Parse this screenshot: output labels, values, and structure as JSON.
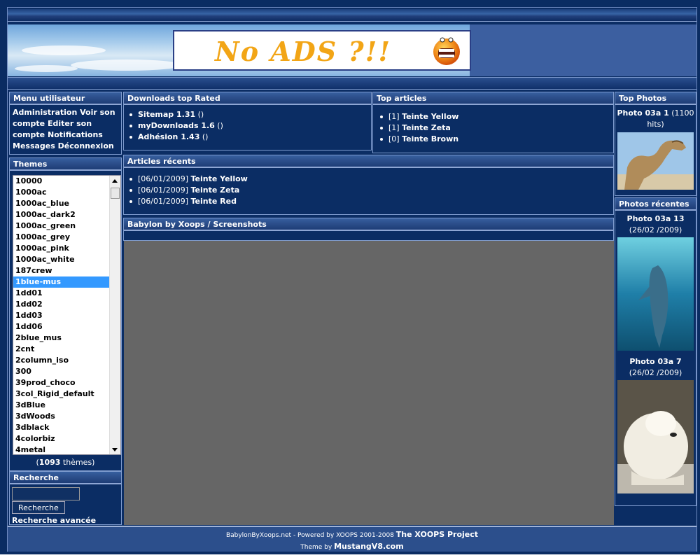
{
  "banner": {
    "ad_text": "No ADS ?!!"
  },
  "menu": {
    "title": "Menu utilisateur",
    "items": [
      "Administration",
      "Voir son compte",
      "Editer son compte",
      "Notifications",
      "Messages",
      "Déconnexion"
    ]
  },
  "themes": {
    "title": "Themes",
    "items": [
      "10000",
      "1000ac",
      "1000ac_blue",
      "1000ac_dark2",
      "1000ac_green",
      "1000ac_grey",
      "1000ac_pink",
      "1000ac_white",
      "187crew",
      "1blue-mus",
      "1dd01",
      "1dd02",
      "1dd03",
      "1dd06",
      "2blue_mus",
      "2cnt",
      "2column_iso",
      "300",
      "39prod_choco",
      "3col_Rigid_default",
      "3dBlue",
      "3dWoods",
      "3dblack",
      "4colorbiz",
      "4metal"
    ],
    "selected": "1blue-mus",
    "count": "1093",
    "count_suffix": " thèmes)",
    "count_prefix": "("
  },
  "search": {
    "title": "Recherche",
    "input_value": "",
    "button": "Recherche",
    "advanced": "Recherche avancée"
  },
  "downloads": {
    "title": "Downloads top Rated",
    "items": [
      {
        "name": "Sitemap 1.31",
        "extra": " ()"
      },
      {
        "name": "myDownloads 1.6",
        "extra": " ()"
      },
      {
        "name": "Adhésion 1.43",
        "extra": " ()"
      }
    ]
  },
  "top_articles": {
    "title": "Top articles",
    "items": [
      {
        "count": "[1] ",
        "name": "Teinte Yellow"
      },
      {
        "count": "[1] ",
        "name": "Teinte Zeta"
      },
      {
        "count": "[0] ",
        "name": "Teinte Brown"
      }
    ]
  },
  "recent_articles": {
    "title": "Articles récents",
    "items": [
      {
        "date": "[06/01/2009] ",
        "name": "Teinte Yellow"
      },
      {
        "date": "[06/01/2009] ",
        "name": "Teinte Zeta"
      },
      {
        "date": "[06/01/2009] ",
        "name": "Teinte Red"
      }
    ]
  },
  "screenshots": {
    "title": "Babylon by Xoops / Screenshots"
  },
  "top_photos": {
    "title": "Top Photos",
    "photo_name": "Photo 03a 1",
    "photo_meta": " (1100 hits)"
  },
  "recent_photos": {
    "title": "Photos récentes",
    "items": [
      {
        "name": "Photo 03a 13",
        "meta": " (26/02 /2009)"
      },
      {
        "name": "Photo 03a 7",
        "meta": " (26/02 /2009)"
      }
    ]
  },
  "footer": {
    "line1": "BabylonByXoops.net - Powered by XOOPS 2001-2008 ",
    "line1_link": "The XOOPS Project",
    "line2": "Theme by ",
    "line2_link": "MustangV8.com"
  },
  "colors": {
    "background": "#0b2d64",
    "content_grey": "#666666",
    "selected": "#3399ff"
  }
}
